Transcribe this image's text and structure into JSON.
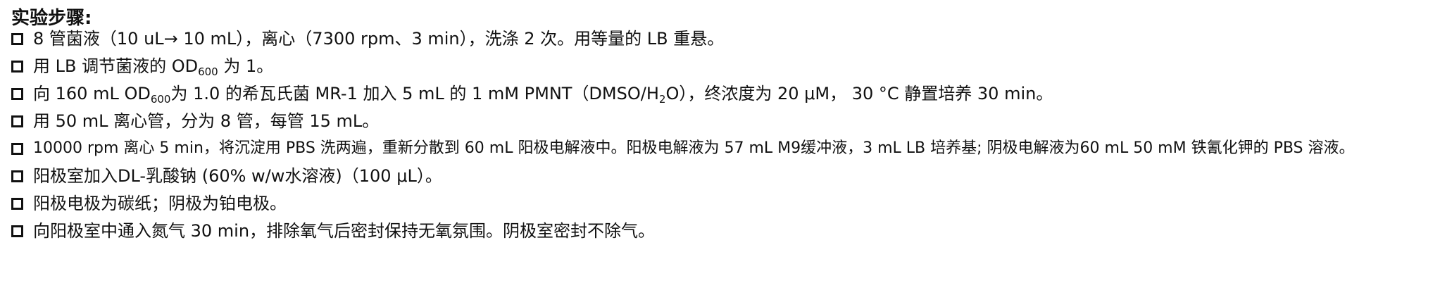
{
  "heading": "实验步骤:",
  "steps": [
    {
      "parts": [
        "8 管菌液（10 uL→ 10 mL），离心（7300 rpm、3 min），洗涤 2 次。用等量的 LB 重悬。"
      ]
    },
    {
      "parts": [
        "用 LB 调节菌液的 OD",
        "600",
        " 为 1。"
      ]
    },
    {
      "parts": [
        "向 160 mL OD",
        "600",
        "为 1.0 的希瓦氏菌 MR-1 加入 5 mL 的 1 mM PMNT（DMSO/H",
        "2",
        "O），终浓度为 20 μM， 30 °C 静置培养 30 min。"
      ]
    },
    {
      "parts": [
        "用 50 mL 离心管，分为 8 管，每管 15 mL。"
      ]
    },
    {
      "parts": [
        "10000 rpm 离心 5 min，将沉淀用 PBS 洗两遍，重新分散到 60 mL 阳极电解液中。阳极电解液为 57 mL M9缓冲液，3 mL LB 培养基; 阴极电解液为60 mL 50 mM 铁氰化钾的 PBS 溶液。"
      ]
    },
    {
      "parts": [
        "阳极室加入DL-乳酸钠 (60% w/w水溶液)（100 μL）。"
      ]
    },
    {
      "parts": [
        "阳极电极为碳纸；阴极为铂电极。"
      ]
    },
    {
      "parts": [
        "向阳极室中通入氮气 30 min，排除氧气后密封保持无氧氛围。阴极室密封不除气。"
      ]
    }
  ]
}
